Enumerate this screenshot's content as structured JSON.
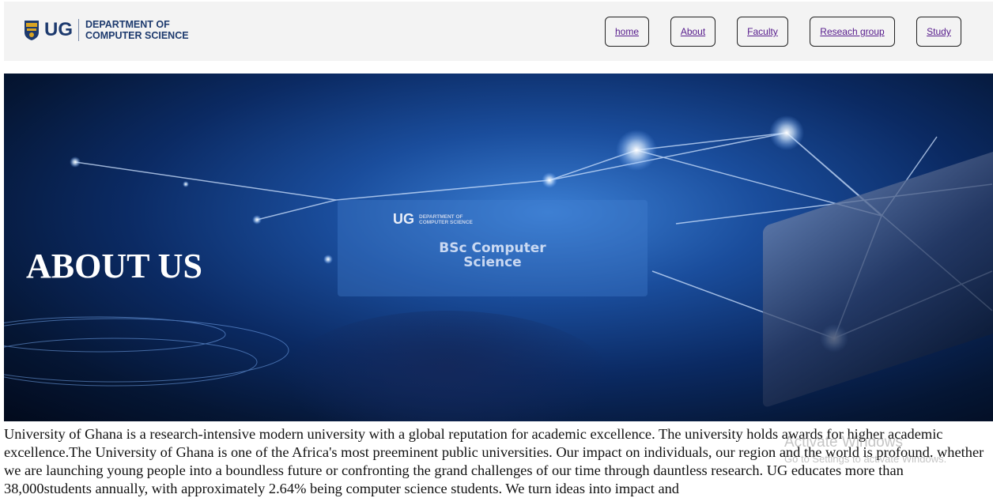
{
  "header": {
    "logo": {
      "ug": "UG",
      "line1": "DEPARTMENT OF",
      "line2": "COMPUTER SCIENCE"
    },
    "nav": [
      {
        "label": "home"
      },
      {
        "label": "About"
      },
      {
        "label": "Faculty"
      },
      {
        "label": "Reseach group"
      },
      {
        "label": "Study"
      }
    ]
  },
  "hero": {
    "title": "ABOUT US",
    "card": {
      "ug": "UG",
      "line1": "DEPARTMENT OF",
      "line2": "COMPUTER SCIENCE",
      "title_line1": "BSc Computer",
      "title_line2": "Science"
    }
  },
  "body": {
    "paragraph": "University of Ghana is a research-intensive modern university with a global reputation for academic excellence. The university holds awards for higher academic excellence.The University of Ghana is one of the Africa's most preeminent public universities. Our impact on individuals, our region and the world is profound. whether we are launching young people into a boundless future or confronting the grand challenges of our time through dauntless research. UG educates more than 38,000students annually, with approximately 2.64% being computer science students. We turn ideas into impact and"
  },
  "overlay": {
    "line1": "Activate Windows",
    "line2": "Go to Settings to activate Windows."
  },
  "colors": {
    "brand_navy": "#1d3a6e",
    "header_bg": "#f3f3f3",
    "link": "#551a8b"
  }
}
